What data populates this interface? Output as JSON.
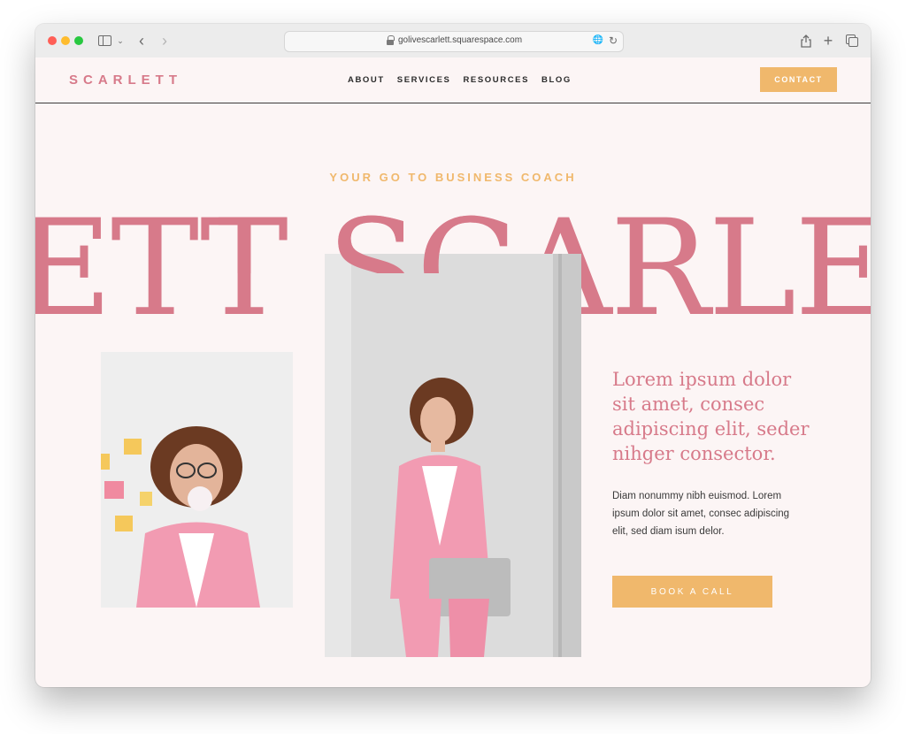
{
  "browser": {
    "url": "golivescarlett.squarespace.com"
  },
  "site": {
    "logo": "SCARLETT",
    "nav": [
      {
        "label": "ABOUT"
      },
      {
        "label": "SERVICES"
      },
      {
        "label": "RESOURCES"
      },
      {
        "label": "BLOG"
      }
    ],
    "contact_label": "CONTACT"
  },
  "hero": {
    "tagline": "YOUR GO TO BUSINESS COACH",
    "big_title": "LETT SCARLETT",
    "headline": "Lorem ipsum dolor sit amet, consec adipiscing elit, seder nihger consector.",
    "body": "Diam nonummy nibh euismod. Lorem ipsum dolor sit amet, consec adipiscing elit, sed diam isum delor.",
    "cta_label": "BOOK A CALL"
  },
  "colors": {
    "accent_pink": "#d77a8a",
    "accent_gold": "#f0b86c",
    "background": "#fcf5f5"
  }
}
